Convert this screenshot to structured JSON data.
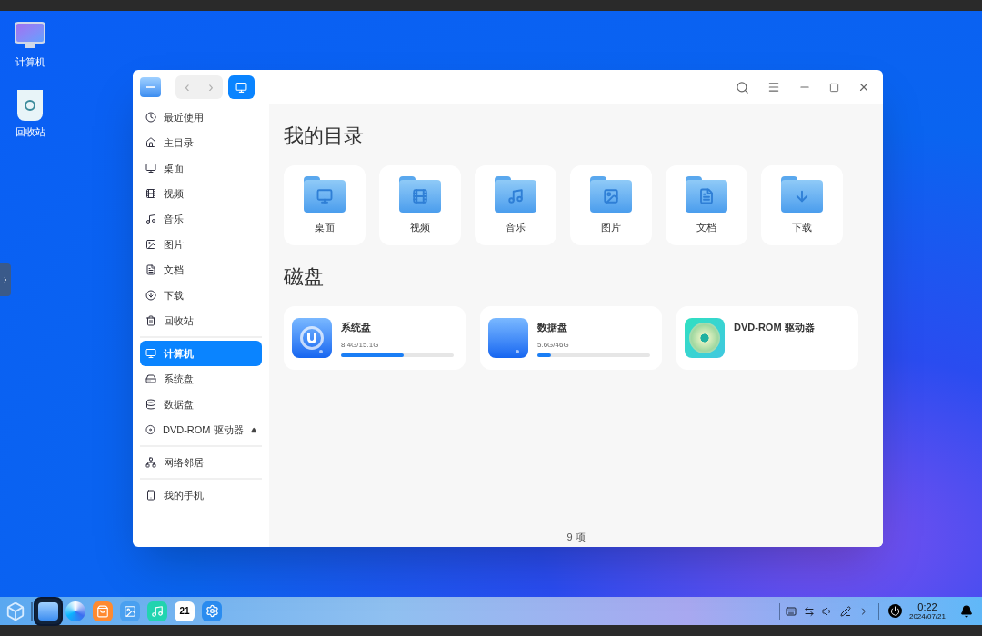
{
  "desktop_icons": [
    {
      "kind": "computer",
      "label": "计算机"
    },
    {
      "kind": "trash",
      "label": "回收站"
    }
  ],
  "window": {
    "nav": {
      "back": "‹",
      "forward": "›"
    },
    "status_bar": "9 项"
  },
  "sidebar": {
    "sections": [
      {
        "items": [
          {
            "label": "最近使用",
            "selected": false
          },
          {
            "label": "主目录",
            "selected": false
          },
          {
            "label": "桌面",
            "selected": false
          },
          {
            "label": "视频",
            "selected": false
          },
          {
            "label": "音乐",
            "selected": false
          },
          {
            "label": "图片",
            "selected": false
          },
          {
            "label": "文档",
            "selected": false
          },
          {
            "label": "下载",
            "selected": false
          },
          {
            "label": "回收站",
            "selected": false
          }
        ]
      },
      {
        "items": [
          {
            "label": "计算机",
            "selected": true
          },
          {
            "label": "系统盘",
            "selected": false
          },
          {
            "label": "数据盘",
            "selected": false
          },
          {
            "label": "DVD-ROM 驱动器",
            "selected": false,
            "ejectable": true
          }
        ]
      },
      {
        "items": [
          {
            "label": "网络邻居",
            "selected": false
          }
        ]
      },
      {
        "items": [
          {
            "label": "我的手机",
            "selected": false
          }
        ]
      }
    ]
  },
  "directories": {
    "title": "我的目录",
    "items": [
      {
        "kind": "desktop",
        "label": "桌面"
      },
      {
        "kind": "video",
        "label": "视频"
      },
      {
        "kind": "music",
        "label": "音乐"
      },
      {
        "kind": "image",
        "label": "图片"
      },
      {
        "kind": "doc",
        "label": "文档"
      },
      {
        "kind": "download",
        "label": "下载"
      }
    ]
  },
  "disks": {
    "title": "磁盘",
    "items": [
      {
        "kind": "system",
        "name": "系统盘",
        "usage": "8.4G/15.1G",
        "level": 0.556
      },
      {
        "kind": "data",
        "name": "数据盘",
        "usage": "5.6G/46G",
        "level": 0.122
      },
      {
        "kind": "dvd",
        "name": "DVD-ROM 驱动器"
      }
    ]
  },
  "taskbar": {
    "dock": [
      {
        "kind": "launcher",
        "selected": false
      },
      {
        "kind": "files",
        "selected": true
      },
      {
        "kind": "browser",
        "selected": false
      },
      {
        "kind": "store",
        "selected": false
      },
      {
        "kind": "photos",
        "selected": false
      },
      {
        "kind": "music",
        "selected": false
      },
      {
        "kind": "calendar",
        "selected": false,
        "text": "21"
      },
      {
        "kind": "settings",
        "selected": false
      }
    ],
    "time": "0:22",
    "date": "2024/07/21"
  }
}
